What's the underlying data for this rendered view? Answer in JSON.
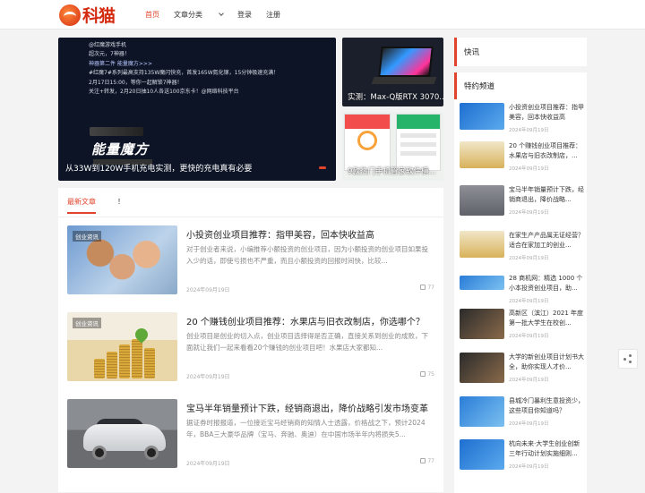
{
  "header": {
    "logo_text": "科猫",
    "nav": [
      {
        "label": "首页",
        "active": true
      },
      {
        "label": "文章分类",
        "dropdown": true
      },
      {
        "label": "登录"
      },
      {
        "label": "注册"
      }
    ]
  },
  "slider": {
    "lines": [
      "@红魔游戏手机",
      "超次元，7神器！",
      "神器第二件 能量魔方>>>",
      "#红魔7#系列最高支持135W魔闪快充，首发165W氮化镓，15分钟极速充满！",
      "2月17日15:00，等你一起解锁7神器！",
      "关注+转发，2月20日抽10人各送100京东卡！@网络科技平台"
    ],
    "poster_title": "能量魔方",
    "caption": "从33W到120W手机充电实测，更快的充电真有必要"
  },
  "thumbs": [
    {
      "caption": "实测：Max-Q版RTX 3070..."
    },
    {
      "caption": "9款热门手机管家软件横..."
    }
  ],
  "list": {
    "tabs": [
      "最新文章",
      "！"
    ],
    "articles": [
      {
        "badge": "创业资讯",
        "title": "小投资创业项目推荐：指甲美容，回本快收益高",
        "desc": "对于创业者来说，小编推荐小额投资的创业项目，因为小额投资的创业项目如果投入少的话，即使亏损也不严重，而且小额投资的回报时间快，比较...",
        "date": "2024年09月19日",
        "likes": "77"
      },
      {
        "badge": "创业资讯",
        "title": "20 个赚钱创业项目推荐：水果店与旧衣改制店，你选哪个？",
        "desc": "创业项目是创业的切入点，创业项目选择得是否正确，直接关系到创业的成败，下面就让我们一起来看看20个赚钱的创业项目吧！水果店大家都知...",
        "date": "2024年09月19日",
        "likes": "75"
      },
      {
        "badge": "",
        "title": "宝马半年销量预计下跌，经销商退出，降价战略引发市场变革",
        "desc": "据证券时报报道，一位接近宝马经销商的知情人士透露，价格战之下，预计2024年，BBA三大豪华品牌（宝马、奔驰、奥迪）在中国市场半年内将损失5...",
        "date": "2024年09月19日",
        "likes": "77"
      }
    ]
  },
  "sidebar": {
    "hot_title": "快讯",
    "channel_title": "特约频道",
    "items": [
      {
        "title": "小投资创业项目推荐：指甲美容，回本快收益高",
        "date": "2024年09月19日"
      },
      {
        "title": "20 个赚钱创业项目推荐：水果店与旧衣改制店，...",
        "date": "2024年09月19日"
      },
      {
        "title": "宝马半年销量预计下跌，经销商退出，降价战略...",
        "date": "2024年09月19日"
      },
      {
        "title": "在家生产产品属无证经营？适合在家加工的创业...",
        "date": "2024年09月19日"
      },
      {
        "title": "28 商机网：精选 1000 个小本投资创业项目，助...",
        "date": "2024年09月19日"
      },
      {
        "title": "高新区（滨江）2021 年度第一批大学生在校创...",
        "date": "2024年09月19日"
      },
      {
        "title": "大学的新创业项目计划书大全，助你实现人才价...",
        "date": "2024年09月19日"
      },
      {
        "title": "县城冷门暴利生意投资少，这些项目你知道吗？",
        "date": "2024年09月19日"
      },
      {
        "title": "杭向未来·大学生创业创新三年行动计划实施细则...",
        "date": "2024年09月19日"
      }
    ]
  },
  "colors": {
    "accent": "#e0452b"
  }
}
